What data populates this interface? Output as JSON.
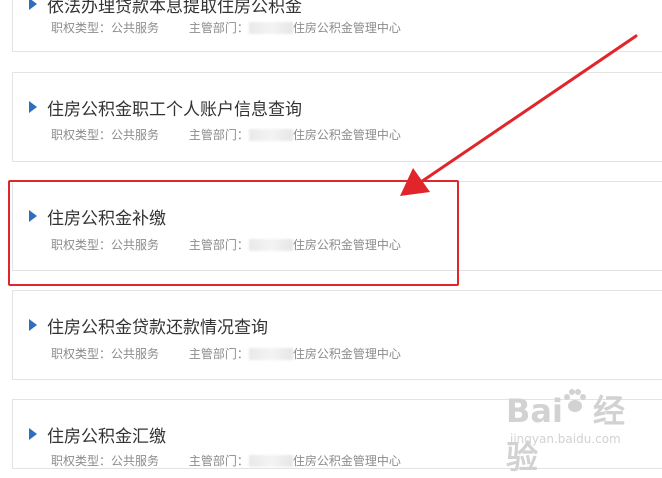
{
  "items": [
    {
      "title": "依法办理贷款本息提取住房公积金",
      "type_label": "职权类型：",
      "type_value": "公共服务",
      "dept_label": "主管部门：",
      "dept_value": "住房公积金管理中心"
    },
    {
      "title": "住房公积金职工个人账户信息查询",
      "type_label": "职权类型：",
      "type_value": "公共服务",
      "dept_label": "主管部门：",
      "dept_value": "住房公积金管理中心"
    },
    {
      "title": "住房公积金补缴",
      "type_label": "职权类型：",
      "type_value": "公共服务",
      "dept_label": "主管部门：",
      "dept_value": "住房公积金管理中心"
    },
    {
      "title": "住房公积金贷款还款情况查询",
      "type_label": "职权类型：",
      "type_value": "公共服务",
      "dept_label": "主管部门：",
      "dept_value": "住房公积金管理中心"
    },
    {
      "title": "住房公积金汇缴",
      "type_label": "职权类型：",
      "type_value": "公共服务",
      "dept_label": "主管部门：",
      "dept_value": "住房公积金管理中心"
    }
  ],
  "annotation": {
    "highlight_color": "#e0262b"
  },
  "watermark": {
    "logo_left": "Bai",
    "logo_right": "经验",
    "url": "jingyan.baidu.com"
  },
  "colors": {
    "accent": "#2d6fbf",
    "title_text": "#333333",
    "meta_text": "#8c8c8c",
    "border": "#e3e3e3"
  }
}
